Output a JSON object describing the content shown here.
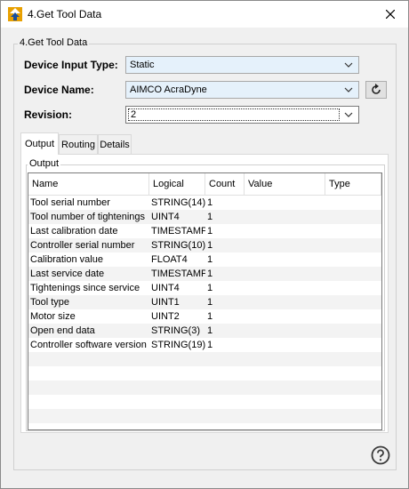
{
  "window": {
    "title": "4.Get Tool Data",
    "icon": "app-up-arrows-icon",
    "close_icon": "close-icon"
  },
  "group": {
    "label": "4.Get Tool Data"
  },
  "fields": {
    "device_input_type": {
      "label": "Device Input Type:",
      "value": "Static"
    },
    "device_name": {
      "label": "Device Name:",
      "value": "AIMCO AcraDyne"
    },
    "revision": {
      "label": "Revision:",
      "value": "2"
    }
  },
  "tabs": [
    {
      "label": "Output",
      "active": true
    },
    {
      "label": "Routing",
      "active": false
    },
    {
      "label": "Details",
      "active": false
    }
  ],
  "output": {
    "group_label": "Output",
    "columns": [
      "Name",
      "Logical",
      "Count",
      "Value",
      "Type"
    ],
    "rows": [
      {
        "name": "Tool serial number",
        "logical": "STRING(14)",
        "count": "1",
        "value": "",
        "type": ""
      },
      {
        "name": "Tool number of tightenings",
        "logical": "UINT4",
        "count": "1",
        "value": "",
        "type": ""
      },
      {
        "name": "Last calibration date",
        "logical": "TIMESTAMP",
        "count": "1",
        "value": "",
        "type": ""
      },
      {
        "name": "Controller serial number",
        "logical": "STRING(10)",
        "count": "1",
        "value": "",
        "type": ""
      },
      {
        "name": "Calibration value",
        "logical": "FLOAT4",
        "count": "1",
        "value": "",
        "type": ""
      },
      {
        "name": "Last service date",
        "logical": "TIMESTAMP",
        "count": "1",
        "value": "",
        "type": ""
      },
      {
        "name": "Tightenings since service",
        "logical": "UINT4",
        "count": "1",
        "value": "",
        "type": ""
      },
      {
        "name": "Tool type",
        "logical": "UINT1",
        "count": "1",
        "value": "",
        "type": ""
      },
      {
        "name": "Motor size",
        "logical": "UINT2",
        "count": "1",
        "value": "",
        "type": ""
      },
      {
        "name": "Open end data",
        "logical": "STRING(3)",
        "count": "1",
        "value": "",
        "type": ""
      },
      {
        "name": "Controller software version",
        "logical": "STRING(19)",
        "count": "1",
        "value": "",
        "type": ""
      }
    ]
  },
  "colors": {
    "combo_bg": "#e5f1fb",
    "accent": "#0078d7",
    "alt_row": "#f3f3f3"
  }
}
